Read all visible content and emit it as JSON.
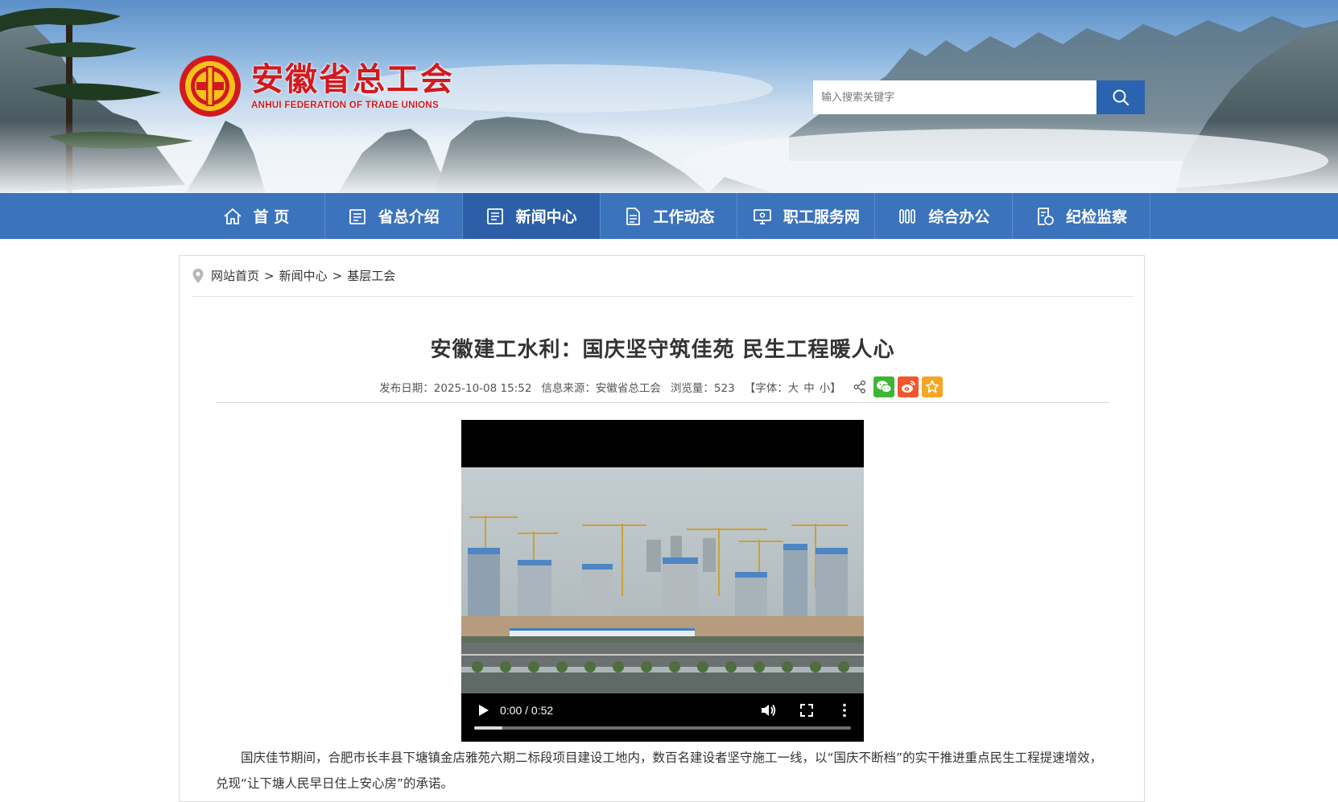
{
  "header": {
    "org_name_cn": "安徽省总工会",
    "org_name_en": "ANHUI FEDERATION OF TRADE UNIONS",
    "search": {
      "placeholder": "输入搜索关键字"
    }
  },
  "nav": {
    "items": [
      {
        "label": "首 页",
        "icon": "home-icon"
      },
      {
        "label": "省总介绍",
        "icon": "intro-icon"
      },
      {
        "label": "新闻中心",
        "icon": "news-icon",
        "active": true
      },
      {
        "label": "工作动态",
        "icon": "document-icon"
      },
      {
        "label": "职工服务网",
        "icon": "monitor-icon"
      },
      {
        "label": "综合办公",
        "icon": "office-icon"
      },
      {
        "label": "纪检监察",
        "icon": "inspection-icon"
      }
    ]
  },
  "breadcrumb": {
    "items": [
      "网站首页",
      "新闻中心",
      "基层工会"
    ],
    "separator": ">"
  },
  "article": {
    "title": "安徽建工水利：国庆坚守筑佳苑  民生工程暖人心",
    "publish_date": "发布日期：2025-10-08 15:52",
    "source": "信息来源：安徽省总工会",
    "views": "浏览量：523",
    "font_label": "【字体：",
    "font_large": "大",
    "font_medium": "中",
    "font_small": "小",
    "font_close": "】",
    "share": [
      "share-icon",
      "wechat-icon",
      "weibo-icon",
      "favorite-icon"
    ],
    "paragraph": "国庆佳节期间，合肥市长丰县下塘镇金店雅苑六期二标段项目建设工地内，数百名建设者坚守施工一线，以“国庆不断档”的实干推进重点民生工程提速增效，兑现“让下塘人民早日住上安心房”的承诺。"
  },
  "video": {
    "time": "0:00 / 0:52",
    "progress_fraction": 0.075
  },
  "colors": {
    "nav_bg": "#3b73bd",
    "nav_active": "#2c5fa8",
    "logo_red": "#d2191e",
    "search_btn": "#2a63b0",
    "wechat": "#3fb536",
    "weibo": "#f0572b",
    "favorite": "#f5a623"
  }
}
